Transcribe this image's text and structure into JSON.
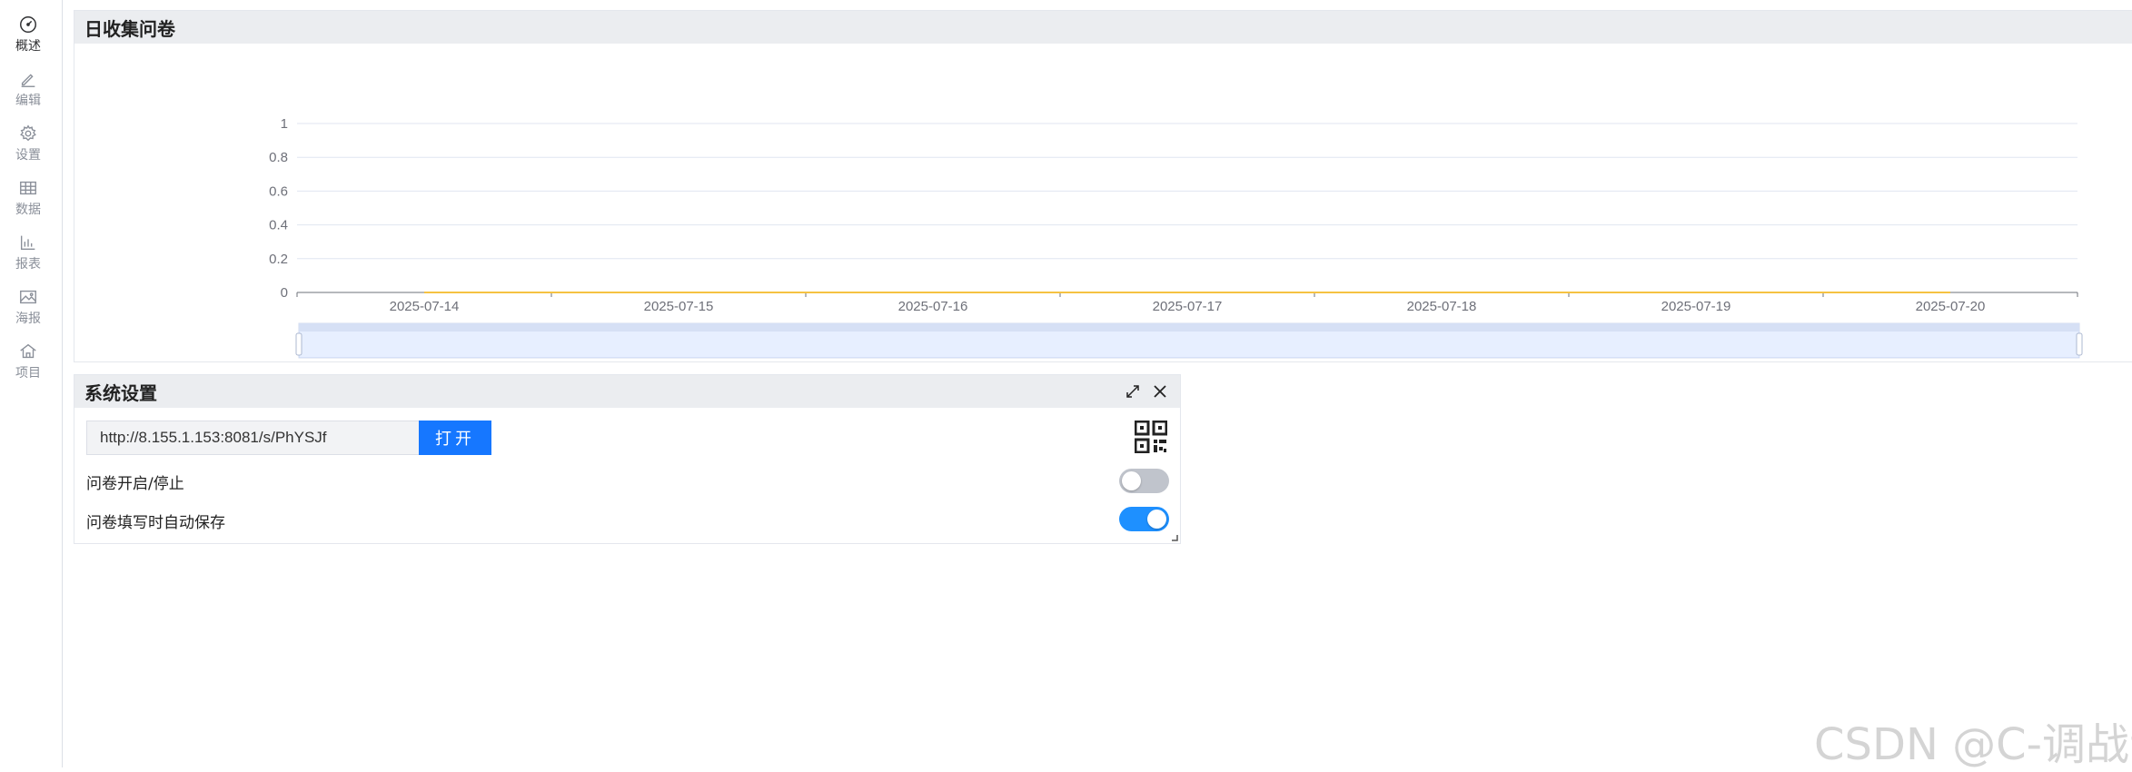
{
  "sidebar": {
    "items": [
      {
        "label": "概述",
        "icon": "dashboard-icon",
        "active": true
      },
      {
        "label": "编辑",
        "icon": "pencil-icon"
      },
      {
        "label": "设置",
        "icon": "gear-icon"
      },
      {
        "label": "数据",
        "icon": "table-icon"
      },
      {
        "label": "报表",
        "icon": "bar-chart-icon"
      },
      {
        "label": "海报",
        "icon": "image-icon"
      },
      {
        "label": "项目",
        "icon": "home-icon"
      }
    ]
  },
  "chart_panel": {
    "title": "日收集问卷"
  },
  "chart_data": {
    "type": "line",
    "title": "",
    "xlabel": "",
    "ylabel": "",
    "categories": [
      "2025-07-14",
      "2025-07-15",
      "2025-07-16",
      "2025-07-17",
      "2025-07-18",
      "2025-07-19",
      "2025-07-20"
    ],
    "y_ticks": [
      "0",
      "0.2",
      "0.4",
      "0.6",
      "0.8",
      "1"
    ],
    "ylim": [
      0,
      1
    ],
    "series": [
      {
        "values": [
          0,
          0,
          0,
          0,
          0,
          0,
          0
        ],
        "color": "#f5c242"
      }
    ],
    "grid": true,
    "has_datazoom_slider": true
  },
  "settings_panel": {
    "title": "系统设置",
    "url_value": "http://8.155.1.153:8081/s/PhYSJf",
    "open_button": "打开",
    "toggle_rows": [
      {
        "label": "问卷开启/停止",
        "enabled": false
      },
      {
        "label": "问卷填写时自动保存",
        "enabled": true
      }
    ]
  },
  "watermark": "CSDN @C-调战士",
  "colors": {
    "accent": "#1677ff",
    "toggle_on": "#1e90ff",
    "toggle_off": "#c0c4cc",
    "series": "#f5c242",
    "header_bg": "#ebedf0"
  }
}
